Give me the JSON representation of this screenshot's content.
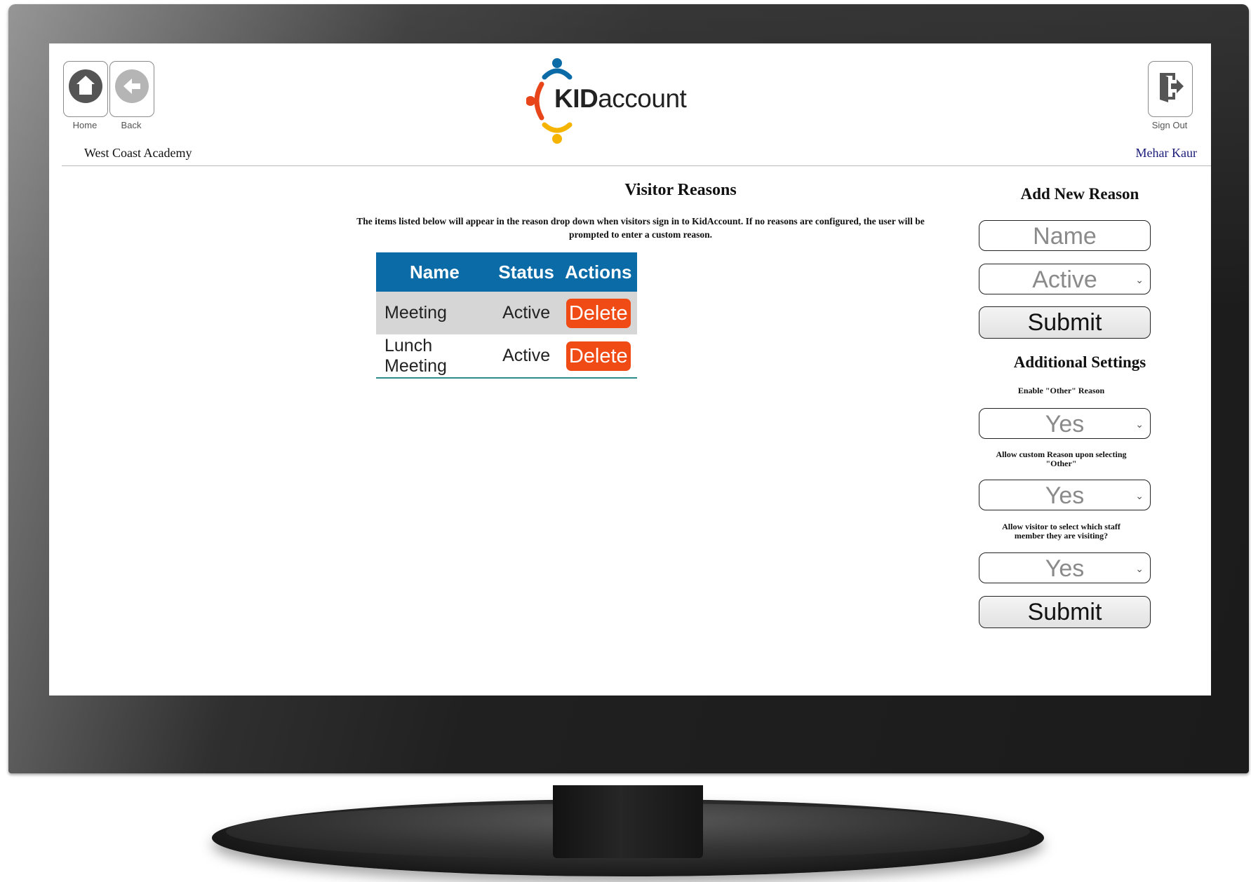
{
  "header": {
    "home_label": "Home",
    "back_label": "Back",
    "signout_label": "Sign Out",
    "school_name": "West Coast Academy",
    "user_name": "Mehar Kaur",
    "logo_bold": "KID",
    "logo_rest": "account"
  },
  "main": {
    "title": "Visitor Reasons",
    "description": "The items listed below will appear in the reason drop down when visitors sign in to KidAccount. If no reasons are configured, the user will be prompted to enter a custom reason.",
    "columns": [
      "Name",
      "Status",
      "Actions"
    ],
    "rows": [
      {
        "name": "Meeting",
        "status": "Active",
        "action": "Delete"
      },
      {
        "name": "Lunch Meeting",
        "status": "Active",
        "action": "Delete"
      }
    ]
  },
  "sidebar": {
    "add_title": "Add New Reason",
    "name_placeholder": "Name",
    "status_selected": "Active",
    "submit_label": "Submit",
    "settings_title": "Additional Settings",
    "enable_other_label": "Enable \"Other\" Reason",
    "enable_other_value": "Yes",
    "allow_custom_label": "Allow custom Reason upon selecting \"Other\"",
    "allow_custom_value": "Yes",
    "allow_staff_label": "Allow visitor to select which staff member they are visiting?",
    "allow_staff_value": "Yes",
    "settings_submit_label": "Submit"
  },
  "colors": {
    "table_header": "#0b6ba7",
    "delete_button": "#f04a15",
    "user_name": "#1a1a7a"
  }
}
